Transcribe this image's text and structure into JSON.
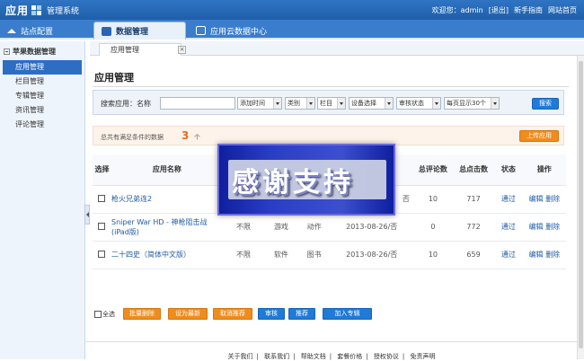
{
  "header": {
    "logo_text": "应用",
    "system_name": "管理系统",
    "greeting": "欢迎您：admin",
    "logout": "[退出]",
    "guide": "新手指南",
    "home": "网站首页"
  },
  "nav": {
    "tabs": [
      {
        "label": "站点配置"
      },
      {
        "label": "数据管理"
      },
      {
        "label": "应用云数据中心"
      }
    ]
  },
  "sidebar": {
    "title": "苹果数据管理",
    "items": [
      {
        "label": "应用管理"
      },
      {
        "label": "栏目管理"
      },
      {
        "label": "专辑管理"
      },
      {
        "label": "资讯管理"
      },
      {
        "label": "评论管理"
      }
    ]
  },
  "page": {
    "tab_label": "应用管理",
    "tab_close": "×",
    "title": "应用管理"
  },
  "search": {
    "label": "搜索应用：名称",
    "name_value": "",
    "time_select": "添加时间",
    "type_select": "类别",
    "column_select": "栏目",
    "device_select": "设备选择",
    "status_select": "审核状态",
    "perpage_select": "每页显示30个",
    "button": "搜索"
  },
  "summary": {
    "text": "总共有满足条件的数据",
    "count": "3",
    "unit": "个",
    "upload_button": "上传应用"
  },
  "table": {
    "headers": {
      "select": "选择",
      "name": "应用名称",
      "comments": "总评论数",
      "clicks": "总点击数",
      "status": "状态",
      "operation": "操作"
    },
    "rows": [
      {
        "name": "枪火兄弟连2",
        "price": "",
        "type": "",
        "category": "",
        "date": "否",
        "comments": "10",
        "clicks": "717",
        "status": "通过",
        "edit": "编辑",
        "delete": "删除"
      },
      {
        "name": "Sniper War HD - 神枪阻击战(iPad版)",
        "price": "不限",
        "type": "游戏",
        "category": "动作",
        "date": "2013-08-26/否",
        "comments": "0",
        "clicks": "772",
        "status": "通过",
        "edit": "编辑",
        "delete": "删除"
      },
      {
        "name": "二十四史（简体中文版）",
        "price": "不限",
        "type": "软件",
        "category": "图书",
        "date": "2013-08-26/否",
        "comments": "10",
        "clicks": "659",
        "status": "通过",
        "edit": "编辑",
        "delete": "删除"
      }
    ]
  },
  "actions": {
    "select_all": "全选",
    "batch_delete": "批量删除",
    "set_latest": "设为最新",
    "cancel_recommend": "取消推荐",
    "review": "审核",
    "recommend": "推荐",
    "add_album": "加入专辑"
  },
  "footer": {
    "links": [
      "关于我们",
      "联系我们",
      "帮助文档",
      "套餐价格",
      "授权协议",
      "免责声明"
    ]
  },
  "overlay": {
    "text": "感谢支持"
  },
  "colors": {
    "header_blue": "#1f5ea9",
    "accent_orange": "#f08c1c",
    "link_blue": "#1f5ba6"
  }
}
